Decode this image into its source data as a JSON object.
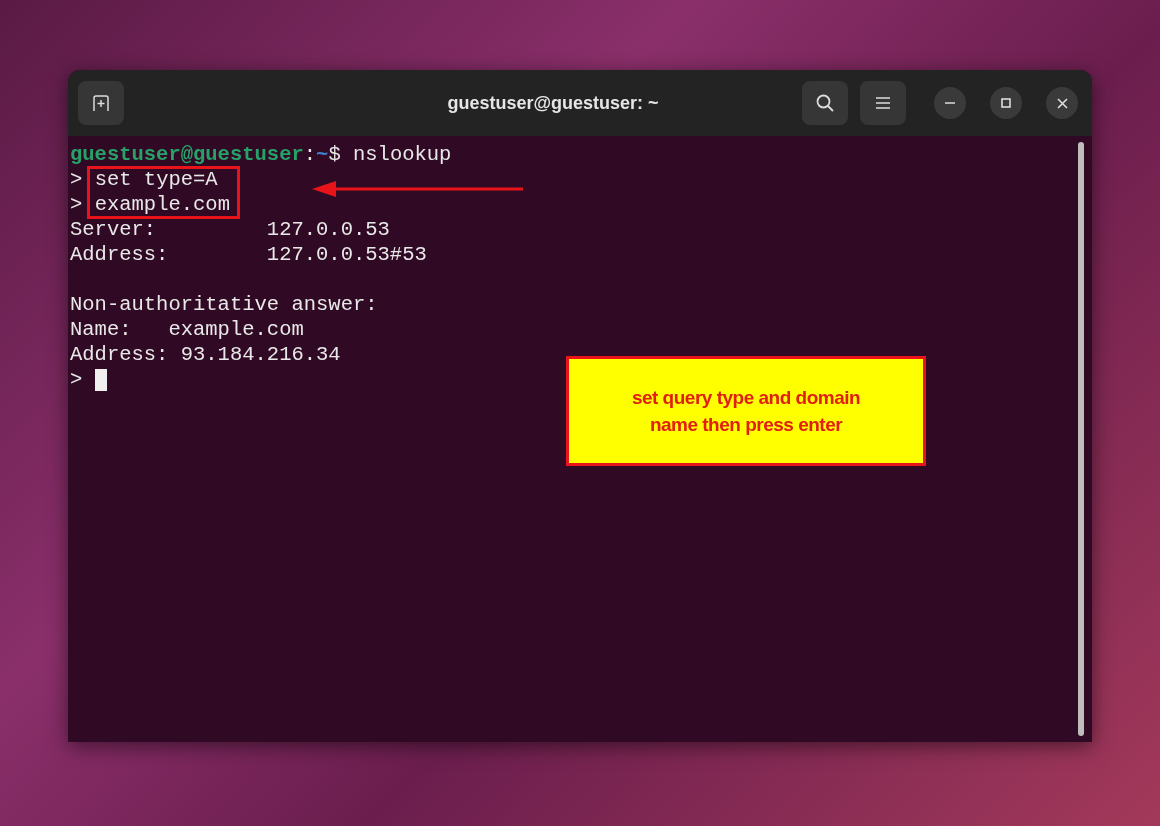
{
  "window": {
    "title": "guestuser@guestuser: ~"
  },
  "terminal": {
    "lines": [
      {
        "kind": "prompt",
        "user_host": "guestuser@guestuser",
        "separator": ":",
        "path": "~",
        "symbol": "$",
        "command": "nslookup"
      },
      {
        "kind": "input",
        "prompt": ">",
        "text": "set type=A"
      },
      {
        "kind": "input",
        "prompt": ">",
        "text": "example.com"
      },
      {
        "kind": "output",
        "text": "Server:         127.0.0.53"
      },
      {
        "kind": "output",
        "text": "Address:        127.0.0.53#53"
      },
      {
        "kind": "blank"
      },
      {
        "kind": "output",
        "text": "Non-authoritative answer:"
      },
      {
        "kind": "output",
        "text": "Name:   example.com"
      },
      {
        "kind": "output",
        "text": "Address: 93.184.216.34"
      },
      {
        "kind": "cursor",
        "prompt": ">"
      }
    ]
  },
  "annotation": {
    "callout": "set query type and domain name then press enter"
  }
}
